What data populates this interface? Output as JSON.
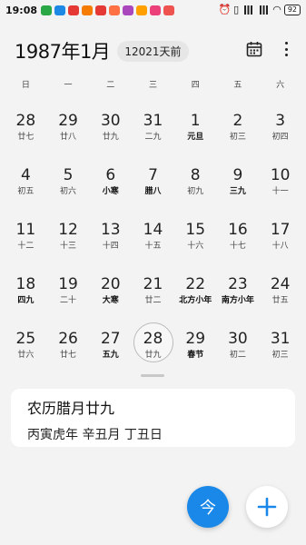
{
  "status_bar": {
    "time": "19:08",
    "battery": "92",
    "left_icon_colors": [
      "#2aa845",
      "#1e88e5",
      "#e53935",
      "#f57c00",
      "#e53935",
      "#ff7043",
      "#ab47bc",
      "#ffa000",
      "#ec407a",
      "#ef5350"
    ]
  },
  "header": {
    "month_title": "1987年1月",
    "days_ago": "12021天前"
  },
  "weekdays": [
    "日",
    "一",
    "二",
    "三",
    "四",
    "五",
    "六"
  ],
  "days": [
    {
      "num": "28",
      "lunar": "廿七",
      "bold": false
    },
    {
      "num": "29",
      "lunar": "廿八",
      "bold": false
    },
    {
      "num": "30",
      "lunar": "廿九",
      "bold": false
    },
    {
      "num": "31",
      "lunar": "二九",
      "bold": false
    },
    {
      "num": "1",
      "lunar": "元旦",
      "bold": true
    },
    {
      "num": "2",
      "lunar": "初三",
      "bold": false
    },
    {
      "num": "3",
      "lunar": "初四",
      "bold": false
    },
    {
      "num": "4",
      "lunar": "初五",
      "bold": false
    },
    {
      "num": "5",
      "lunar": "初六",
      "bold": false
    },
    {
      "num": "6",
      "lunar": "小寒",
      "bold": true
    },
    {
      "num": "7",
      "lunar": "腊八",
      "bold": true
    },
    {
      "num": "8",
      "lunar": "初九",
      "bold": false
    },
    {
      "num": "9",
      "lunar": "三九",
      "bold": true
    },
    {
      "num": "10",
      "lunar": "十一",
      "bold": false
    },
    {
      "num": "11",
      "lunar": "十二",
      "bold": false
    },
    {
      "num": "12",
      "lunar": "十三",
      "bold": false
    },
    {
      "num": "13",
      "lunar": "十四",
      "bold": false
    },
    {
      "num": "14",
      "lunar": "十五",
      "bold": false
    },
    {
      "num": "15",
      "lunar": "十六",
      "bold": false
    },
    {
      "num": "16",
      "lunar": "十七",
      "bold": false
    },
    {
      "num": "17",
      "lunar": "十八",
      "bold": false
    },
    {
      "num": "18",
      "lunar": "四九",
      "bold": true
    },
    {
      "num": "19",
      "lunar": "二十",
      "bold": false
    },
    {
      "num": "20",
      "lunar": "大寒",
      "bold": true
    },
    {
      "num": "21",
      "lunar": "廿二",
      "bold": false
    },
    {
      "num": "22",
      "lunar": "北方小年",
      "bold": true
    },
    {
      "num": "23",
      "lunar": "南方小年",
      "bold": true
    },
    {
      "num": "24",
      "lunar": "廿五",
      "bold": false
    },
    {
      "num": "25",
      "lunar": "廿六",
      "bold": false
    },
    {
      "num": "26",
      "lunar": "廿七",
      "bold": false
    },
    {
      "num": "27",
      "lunar": "五九",
      "bold": true
    },
    {
      "num": "28",
      "lunar": "廿九",
      "bold": false,
      "selected": true
    },
    {
      "num": "29",
      "lunar": "春节",
      "bold": true
    },
    {
      "num": "30",
      "lunar": "初二",
      "bold": false
    },
    {
      "num": "31",
      "lunar": "初三",
      "bold": false
    }
  ],
  "info_card": {
    "title": "农历腊月廿九",
    "subtitle": "丙寅虎年 辛丑月 丁丑日"
  },
  "buttons": {
    "today_label": "今",
    "add_label": "+"
  },
  "colors": {
    "accent": "#1a88e8",
    "background": "#f3f3f3"
  }
}
